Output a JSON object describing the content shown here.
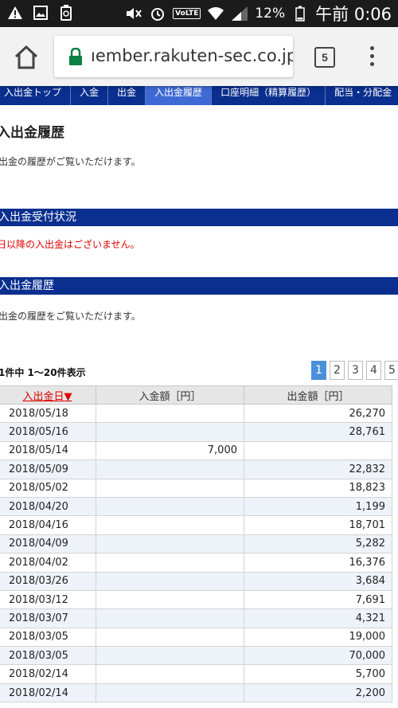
{
  "status_bar": {
    "battery": "12%",
    "time": "午前 0:06",
    "volte": "VoLTE"
  },
  "browser": {
    "url": "ıember.rakuten-sec.co.jp",
    "tab_count": "5"
  },
  "subnav": {
    "items": [
      {
        "label": "入出金トップ"
      },
      {
        "label": "入金"
      },
      {
        "label": "出金"
      },
      {
        "label": "入出金履歴"
      },
      {
        "label": "口座明細（精算履歴）"
      },
      {
        "label": "配当・分配金"
      }
    ],
    "active_index": 3
  },
  "page_title": "入出金履歴",
  "intro_text": "出金の履歴がご覧いただけます。",
  "section1": {
    "title": "入出金受付状況",
    "notice": "日以降の入出金はございません。"
  },
  "section2": {
    "title": "入出金履歴",
    "text": "出金の履歴をご覧いただけます。"
  },
  "result_count": "1件中 1～20件表示",
  "pager": [
    "1",
    "2",
    "3",
    "4",
    "5"
  ],
  "pager_current": "1",
  "colors": {
    "nav_blue": "#0a2f8f",
    "nav_active": "#3f6ad6",
    "notice_red": "#e00000",
    "pager_active": "#4a90d9"
  },
  "table": {
    "headers": [
      "入出金日▼",
      "入金額［円］",
      "出金額［円］"
    ],
    "rows": [
      [
        "2018/05/18",
        "",
        "26,270"
      ],
      [
        "2018/05/16",
        "",
        "28,761"
      ],
      [
        "2018/05/14",
        "7,000",
        ""
      ],
      [
        "2018/05/09",
        "",
        "22,832"
      ],
      [
        "2018/05/02",
        "",
        "18,823"
      ],
      [
        "2018/04/20",
        "",
        "1,199"
      ],
      [
        "2018/04/16",
        "",
        "18,701"
      ],
      [
        "2018/04/09",
        "",
        "5,282"
      ],
      [
        "2018/04/02",
        "",
        "16,376"
      ],
      [
        "2018/03/26",
        "",
        "3,684"
      ],
      [
        "2018/03/12",
        "",
        "7,691"
      ],
      [
        "2018/03/07",
        "",
        "4,321"
      ],
      [
        "2018/03/05",
        "",
        "19,000"
      ],
      [
        "2018/03/05",
        "",
        "70,000"
      ],
      [
        "2018/02/14",
        "",
        "5,700"
      ],
      [
        "2018/02/14",
        "",
        "2,200"
      ]
    ]
  }
}
